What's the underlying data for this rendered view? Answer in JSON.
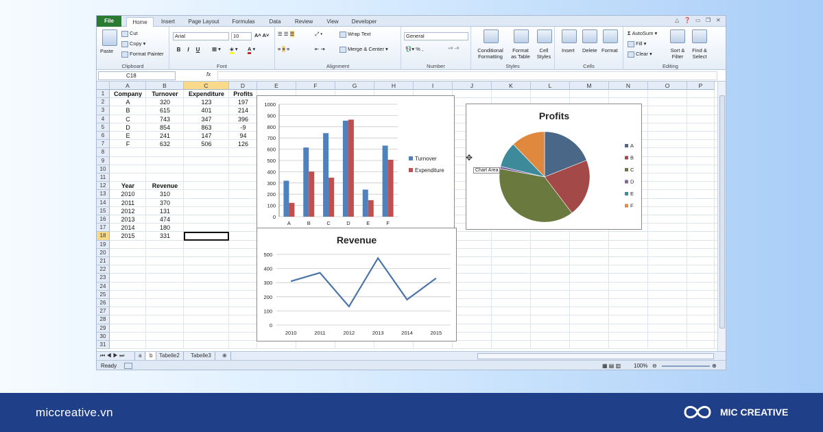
{
  "ribbon": {
    "tabs": [
      "File",
      "Home",
      "Insert",
      "Page Layout",
      "Formulas",
      "Data",
      "Review",
      "View",
      "Developer"
    ],
    "clipboard": {
      "paste": "Paste",
      "cut": "Cut",
      "copy": "Copy",
      "format_painter": "Format Painter",
      "label": "Clipboard"
    },
    "font": {
      "name": "Arial",
      "size": "10",
      "bold": "B",
      "italic": "I",
      "underline": "U",
      "label": "Font"
    },
    "alignment": {
      "wrap": "Wrap Text",
      "merge": "Merge & Center",
      "label": "Alignment"
    },
    "number": {
      "format": "General",
      "label": "Number"
    },
    "styles": {
      "conditional": "Conditional",
      "conditional2": "Formatting",
      "format_as": "Format",
      "format_as2": "as Table",
      "cell": "Cell",
      "cell2": "Styles",
      "label": "Styles"
    },
    "cells": {
      "insert": "Insert",
      "delete": "Delete",
      "format": "Format",
      "label": "Cells"
    },
    "editing": {
      "autosum": "AutoSum",
      "fill": "Fill",
      "clear": "Clear",
      "sort": "Sort &",
      "sort2": "Filter",
      "find": "Find &",
      "find2": "Select",
      "label": "Editing"
    }
  },
  "formula_bar": {
    "name_box": "C18",
    "fx": "fx",
    "value": ""
  },
  "columns": [
    "A",
    "B",
    "C",
    "D",
    "E",
    "F",
    "G",
    "H",
    "I",
    "J",
    "K",
    "L",
    "M",
    "N",
    "O",
    "P"
  ],
  "rows": [
    "1",
    "2",
    "3",
    "4",
    "5",
    "6",
    "7",
    "8",
    "9",
    "10",
    "11",
    "12",
    "13",
    "14",
    "15",
    "16",
    "17",
    "18",
    "19",
    "20",
    "21",
    "22",
    "23",
    "24",
    "25",
    "26",
    "27",
    "28",
    "29",
    "30",
    "31"
  ],
  "table1": {
    "headers": [
      "Company",
      "Turnover",
      "Expenditure",
      "Profits"
    ],
    "rows": [
      [
        "A",
        "320",
        "123",
        "197"
      ],
      [
        "B",
        "615",
        "401",
        "214"
      ],
      [
        "C",
        "743",
        "347",
        "396"
      ],
      [
        "D",
        "854",
        "863",
        "-9"
      ],
      [
        "E",
        "241",
        "147",
        "94"
      ],
      [
        "F",
        "632",
        "506",
        "126"
      ]
    ]
  },
  "table2": {
    "headers": [
      "Year",
      "Revenue"
    ],
    "rows": [
      [
        "2010",
        "310"
      ],
      [
        "2011",
        "370"
      ],
      [
        "2012",
        "131"
      ],
      [
        "2013",
        "474"
      ],
      [
        "2014",
        "180"
      ],
      [
        "2015",
        "331"
      ]
    ]
  },
  "tooltip": "Chart Area",
  "sheets": [
    "a",
    "b",
    "Tabelle2",
    "Tabelle3"
  ],
  "status": {
    "ready": "Ready",
    "zoom": "100%"
  },
  "footer": {
    "site": "miccreative.vn",
    "brand": "MIC CREATIVE"
  },
  "colors": {
    "blue": "#4f81bd",
    "red": "#c0504d",
    "green": "#9bbb59",
    "purple": "#8064a2",
    "teal": "#4bacc6",
    "orange": "#f79646",
    "pie_green": "#6a7a3f",
    "pie_blue": "#4a6787",
    "pie_red": "#a34a48",
    "pie_teal": "#3d8a9a",
    "pie_orange": "#e0893e"
  },
  "chart_data": [
    {
      "type": "bar",
      "categories": [
        "A",
        "B",
        "C",
        "D",
        "E",
        "F"
      ],
      "series": [
        {
          "name": "Turnover",
          "values": [
            320,
            615,
            743,
            854,
            241,
            632
          ]
        },
        {
          "name": "Expenditure",
          "values": [
            123,
            401,
            347,
            863,
            147,
            506
          ]
        }
      ],
      "ylim": [
        0,
        1000
      ],
      "yticks": [
        0,
        100,
        200,
        300,
        400,
        500,
        600,
        700,
        800,
        900,
        1000
      ],
      "grid": true,
      "legend": "right"
    },
    {
      "type": "pie",
      "title": "Profits",
      "categories": [
        "A",
        "B",
        "C",
        "D",
        "E",
        "F"
      ],
      "values": [
        197,
        214,
        396,
        -9,
        94,
        126
      ],
      "legend": "right"
    },
    {
      "type": "line",
      "title": "Revenue",
      "x": [
        "2010",
        "2011",
        "2012",
        "2013",
        "2014",
        "2015"
      ],
      "values": [
        310,
        370,
        131,
        474,
        180,
        331
      ],
      "ylim": [
        0,
        500
      ],
      "yticks": [
        0,
        100,
        200,
        300,
        400,
        500
      ],
      "grid": true
    }
  ]
}
